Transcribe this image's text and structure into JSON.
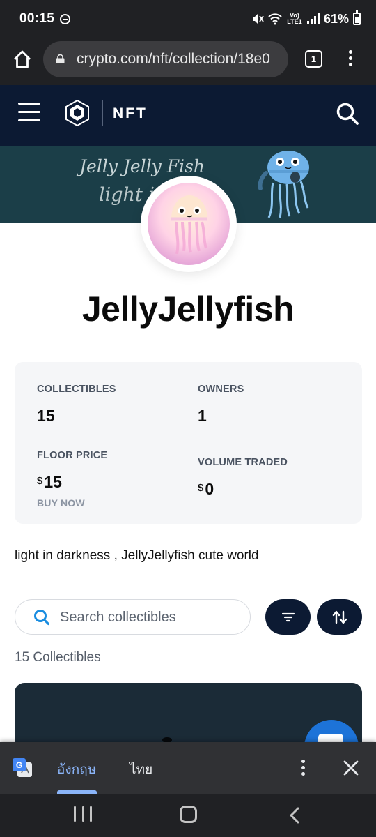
{
  "status_bar": {
    "time": "00:15",
    "network_label": "Vo) LTE1",
    "battery": "61%"
  },
  "browser": {
    "url": "crypto.com/nft/collection/18e0",
    "tab_count": "1"
  },
  "site_header": {
    "logo_text": "NFT"
  },
  "banner": {
    "text_line1": "Jelly Jelly Fish",
    "text_line2": "light in"
  },
  "collection": {
    "title": "JellyJellyfish",
    "description": "light in darkness , JellyJellyfish cute world"
  },
  "stats": {
    "collectibles_label": "COLLECTIBLES",
    "collectibles_value": "15",
    "owners_label": "OWNERS",
    "owners_value": "1",
    "floor_price_label": "FLOOR PRICE",
    "floor_price_currency": "$",
    "floor_price_value": "15",
    "buy_now_label": "BUY NOW",
    "volume_label": "VOLUME TRADED",
    "volume_currency": "$",
    "volume_value": "0"
  },
  "search": {
    "placeholder": "Search collectibles"
  },
  "collectibles_count": "15 Collectibles",
  "translate_bar": {
    "source_lang": "อังกฤษ",
    "target_lang": "ไทย"
  },
  "colors": {
    "navy": "#0c1a33",
    "search_icon": "#1a8de0",
    "translate_accent": "#8ab4f8"
  },
  "icons": [
    "home-icon",
    "lock-icon",
    "menu-icon",
    "search-icon",
    "filter-icon",
    "sort-icon",
    "google-translate-icon",
    "close-icon",
    "chat-icon"
  ]
}
